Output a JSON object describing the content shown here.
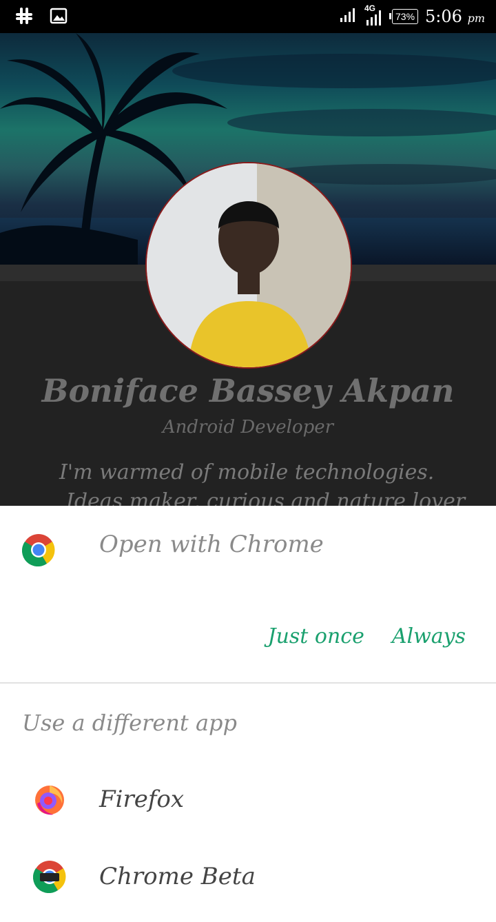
{
  "status_bar": {
    "network": "4G",
    "battery": "73%",
    "time": "5:06",
    "ampm": "pm"
  },
  "profile": {
    "name": "Boniface Bassey Akpan",
    "role": "Android Developer",
    "bio_line1": "I'm warmed of mobile technologies.",
    "bio_line2": "Ideas maker, curious and nature lover"
  },
  "dialog": {
    "open_with": "Open with Chrome",
    "just_once": "Just once",
    "always": "Always",
    "different_app": "Use a different app",
    "apps": [
      {
        "label": "Firefox",
        "icon": "firefox-icon"
      },
      {
        "label": "Chrome Beta",
        "icon": "chrome-beta-icon"
      }
    ]
  },
  "colors": {
    "accent": "#1aa06e",
    "status_bar": "#000000",
    "sheet": "#ffffff"
  }
}
